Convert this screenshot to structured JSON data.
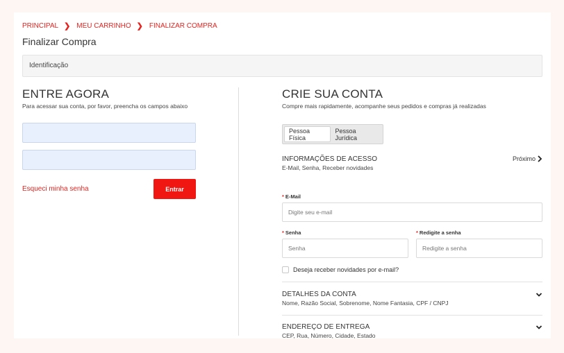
{
  "breadcrumb": [
    "PRINCIPAL",
    "MEU CARRINHO",
    "FINALIZAR COMPRA"
  ],
  "page_title": "Finalizar Compra",
  "step_bar": "Identificação",
  "login": {
    "title": "ENTRE AGORA",
    "subtitle": "Para acessar sua conta, por favor, preencha os campos abaixo",
    "forgot_label": "Esqueci minha senha",
    "submit_label": "Entrar"
  },
  "register": {
    "title": "CRIE SUA CONTA",
    "subtitle": "Compre mais rapidamente, acompanhe seus pedidos e compras já realizadas",
    "person_types": [
      "Pessoa Física",
      "Pessoa Jurídica"
    ],
    "selected_person_type": "Pessoa Física",
    "access": {
      "title": "INFORMAÇÕES DE ACESSO",
      "subtitle": "E-Mail, Senha, Receber novidades",
      "next_label": "Próximo",
      "email_label": "E-Mail",
      "email_placeholder": "Digite seu e-mail",
      "password_label": "Senha",
      "password_placeholder": "Senha",
      "confirm_label": "Redigite a senha",
      "confirm_placeholder": "Redigite a senha",
      "newsletter_label": "Deseja receber novidades por e-mail?",
      "required_marker": "*"
    },
    "account_details": {
      "title": "DETALHES DA CONTA",
      "subtitle": "Nome, Razão Social, Sobrenome, Nome Fantasia, CPF / CNPJ"
    },
    "delivery": {
      "title": "ENDEREÇO DE ENTREGA",
      "subtitle": "CEP, Rua, Número, Cidade, Estado"
    }
  },
  "colors": {
    "accent": "#e52420",
    "button": "#f01612",
    "autofill": "#e8f0fe",
    "background": "#fdf6f3"
  }
}
